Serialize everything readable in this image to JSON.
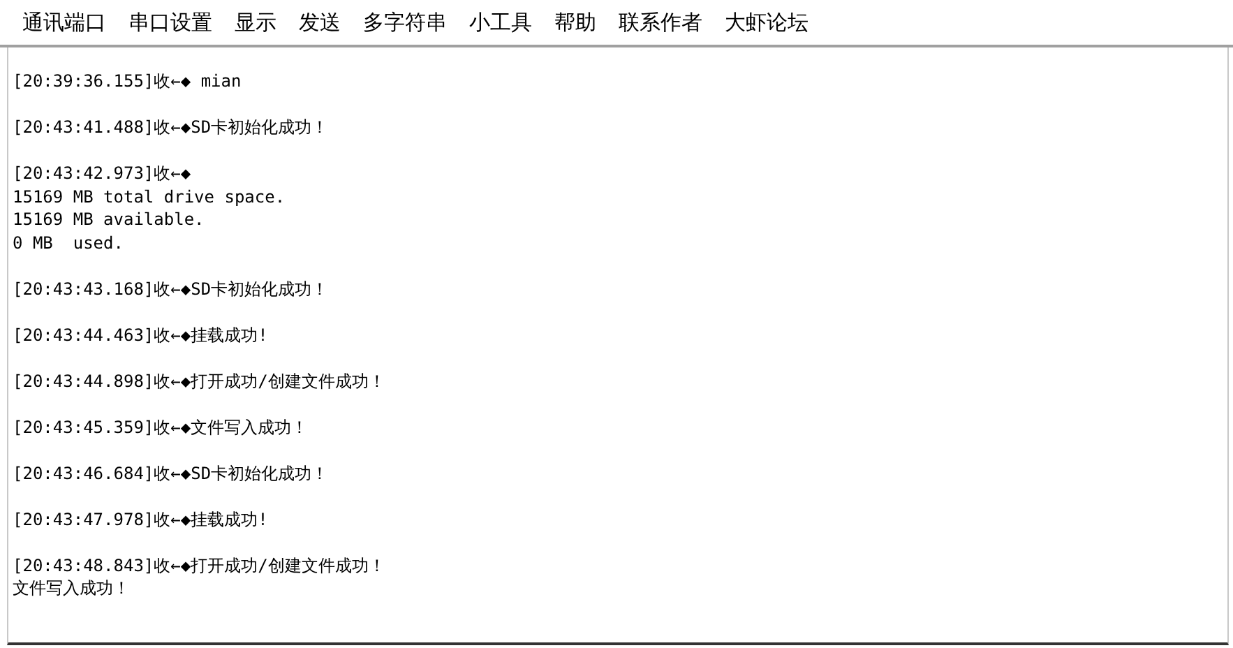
{
  "menu_bar": {
    "items": [
      "通讯端口",
      "串口设置",
      "显示",
      "发送",
      "多字符串",
      "小工具",
      "帮助",
      "联系作者",
      "大虾论坛"
    ]
  },
  "log": {
    "entries": [
      {
        "lines": [
          "[20:39:36.155]收←◆ mian"
        ]
      },
      {
        "lines": [
          "[20:43:41.488]收←◆SD卡初始化成功！"
        ]
      },
      {
        "lines": [
          "[20:43:42.973]收←◆",
          "15169 MB total drive space.",
          "15169 MB available.",
          "0 MB  used."
        ]
      },
      {
        "lines": [
          "[20:43:43.168]收←◆SD卡初始化成功！"
        ]
      },
      {
        "lines": [
          "[20:43:44.463]收←◆挂载成功!"
        ]
      },
      {
        "lines": [
          "[20:43:44.898]收←◆打开成功/创建文件成功！"
        ]
      },
      {
        "lines": [
          "[20:43:45.359]收←◆文件写入成功！"
        ]
      },
      {
        "lines": [
          "[20:43:46.684]收←◆SD卡初始化成功！"
        ]
      },
      {
        "lines": [
          "[20:43:47.978]收←◆挂载成功!"
        ]
      },
      {
        "lines": [
          "[20:43:48.843]收←◆打开成功/创建文件成功！",
          "文件写入成功！"
        ]
      }
    ]
  }
}
